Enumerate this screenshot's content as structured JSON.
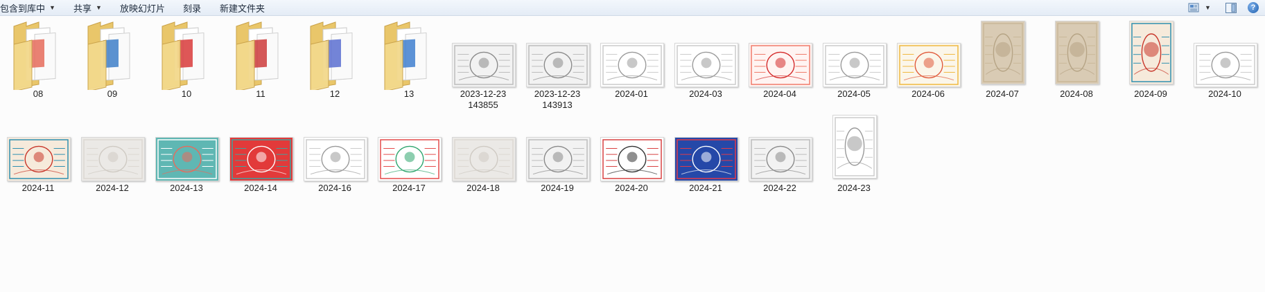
{
  "toolbar": {
    "include_library": "包含到库中",
    "share": "共享",
    "slideshow": "放映幻灯片",
    "burn": "刻录",
    "new_folder": "新建文件夹"
  },
  "folders": [
    {
      "label": "08",
      "paper_color": "#e56b5a"
    },
    {
      "label": "09",
      "paper_color": "#3e7fc8"
    },
    {
      "label": "10",
      "paper_color": "#d83a3a"
    },
    {
      "label": "11",
      "paper_color": "#cc3b3b"
    },
    {
      "label": "12",
      "paper_color": "#5b6fd0"
    },
    {
      "label": "13",
      "paper_color": "#3f7fcf"
    }
  ],
  "row1_images": [
    {
      "label": "2023-12-23",
      "label2": "143855",
      "theme": "sketch"
    },
    {
      "label": "2023-12-23",
      "label2": "143913",
      "theme": "sketch"
    },
    {
      "label": "2024-01",
      "theme": "lineart"
    },
    {
      "label": "2024-03",
      "theme": "lineart"
    },
    {
      "label": "2024-04",
      "theme": "red"
    },
    {
      "label": "2024-05",
      "theme": "lineart"
    },
    {
      "label": "2024-06",
      "theme": "color"
    },
    {
      "label": "2024-07",
      "theme": "beige"
    },
    {
      "label": "2024-08",
      "theme": "beige"
    },
    {
      "label": "2024-09",
      "theme": "dragon-color"
    },
    {
      "label": "2024-10",
      "theme": "lineart"
    }
  ],
  "row2_images": [
    {
      "label": "2024-11",
      "theme": "dragon-color"
    },
    {
      "label": "2024-12",
      "theme": "pale"
    },
    {
      "label": "2024-13",
      "theme": "teal"
    },
    {
      "label": "2024-14",
      "theme": "red-frame"
    },
    {
      "label": "2024-16",
      "theme": "lineart"
    },
    {
      "label": "2024-17",
      "theme": "green"
    },
    {
      "label": "2024-18",
      "theme": "pale"
    },
    {
      "label": "2024-19",
      "theme": "sketch"
    },
    {
      "label": "2024-20",
      "theme": "lion"
    },
    {
      "label": "2024-21",
      "theme": "blue-lion"
    },
    {
      "label": "2024-22",
      "theme": "sketch"
    },
    {
      "label": "2024-23",
      "theme": "lineart"
    }
  ],
  "icons": {
    "view": "view-icon",
    "preview_pane": "preview-pane-icon",
    "help": "help-icon"
  },
  "help_glyph": "?"
}
